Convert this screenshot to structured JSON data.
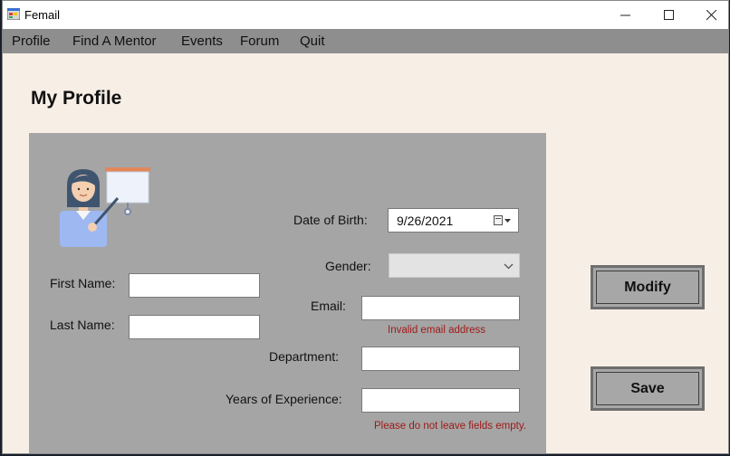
{
  "window": {
    "title": "Femail",
    "icon": "app-window-icon"
  },
  "menu": {
    "items": [
      "Profile",
      "Find A Mentor",
      "Events",
      "Forum",
      "Quit"
    ]
  },
  "page": {
    "title": "My Profile"
  },
  "form": {
    "illustration": "teacher-presenting-illustration",
    "first_name": {
      "label": "First Name:",
      "value": ""
    },
    "last_name": {
      "label": "Last Name:",
      "value": ""
    },
    "date_of_birth": {
      "label": "Date of Birth:",
      "value": "9/26/2021"
    },
    "gender": {
      "label": "Gender:",
      "value": ""
    },
    "email": {
      "label": "Email:",
      "value": "",
      "error": "Invalid email address"
    },
    "department": {
      "label": "Department:",
      "value": ""
    },
    "years_experience": {
      "label": "Years of Experience:",
      "value": "",
      "error": "Please do not leave fields empty."
    }
  },
  "actions": {
    "modify_label": "Modify",
    "save_label": "Save"
  },
  "colors": {
    "background": "#f7efe6",
    "panel": "#a5a5a5",
    "menubar": "#8e8e8e",
    "error_text": "#a01a1a"
  }
}
